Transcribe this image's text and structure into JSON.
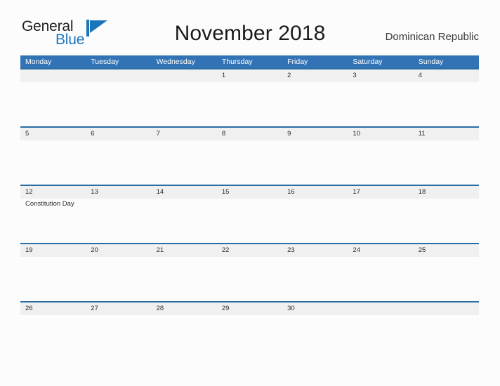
{
  "brand": {
    "name_part1": "General",
    "name_part2": "Blue",
    "flag_icon": "blue-flag-icon",
    "color_dark": "#231f20",
    "color_blue": "#1b75bb"
  },
  "header": {
    "title": "November 2018",
    "country": "Dominican Republic"
  },
  "calendar": {
    "accent_header_color": "#3273b5",
    "row_divider_color": "#2b6ca3",
    "day_strip_color": "#f0f0f0",
    "weekdays": [
      "Monday",
      "Tuesday",
      "Wednesday",
      "Thursday",
      "Friday",
      "Saturday",
      "Sunday"
    ],
    "weeks": [
      {
        "days": [
          {
            "date": "",
            "note": ""
          },
          {
            "date": "",
            "note": ""
          },
          {
            "date": "",
            "note": ""
          },
          {
            "date": "1",
            "note": ""
          },
          {
            "date": "2",
            "note": ""
          },
          {
            "date": "3",
            "note": ""
          },
          {
            "date": "4",
            "note": ""
          }
        ]
      },
      {
        "days": [
          {
            "date": "5",
            "note": ""
          },
          {
            "date": "6",
            "note": ""
          },
          {
            "date": "7",
            "note": ""
          },
          {
            "date": "8",
            "note": ""
          },
          {
            "date": "9",
            "note": ""
          },
          {
            "date": "10",
            "note": ""
          },
          {
            "date": "11",
            "note": ""
          }
        ]
      },
      {
        "days": [
          {
            "date": "12",
            "note": "Constitution Day"
          },
          {
            "date": "13",
            "note": ""
          },
          {
            "date": "14",
            "note": ""
          },
          {
            "date": "15",
            "note": ""
          },
          {
            "date": "16",
            "note": ""
          },
          {
            "date": "17",
            "note": ""
          },
          {
            "date": "18",
            "note": ""
          }
        ]
      },
      {
        "days": [
          {
            "date": "19",
            "note": ""
          },
          {
            "date": "20",
            "note": ""
          },
          {
            "date": "21",
            "note": ""
          },
          {
            "date": "22",
            "note": ""
          },
          {
            "date": "23",
            "note": ""
          },
          {
            "date": "24",
            "note": ""
          },
          {
            "date": "25",
            "note": ""
          }
        ]
      },
      {
        "days": [
          {
            "date": "26",
            "note": ""
          },
          {
            "date": "27",
            "note": ""
          },
          {
            "date": "28",
            "note": ""
          },
          {
            "date": "29",
            "note": ""
          },
          {
            "date": "30",
            "note": ""
          },
          {
            "date": "",
            "note": ""
          },
          {
            "date": "",
            "note": ""
          }
        ]
      }
    ]
  }
}
